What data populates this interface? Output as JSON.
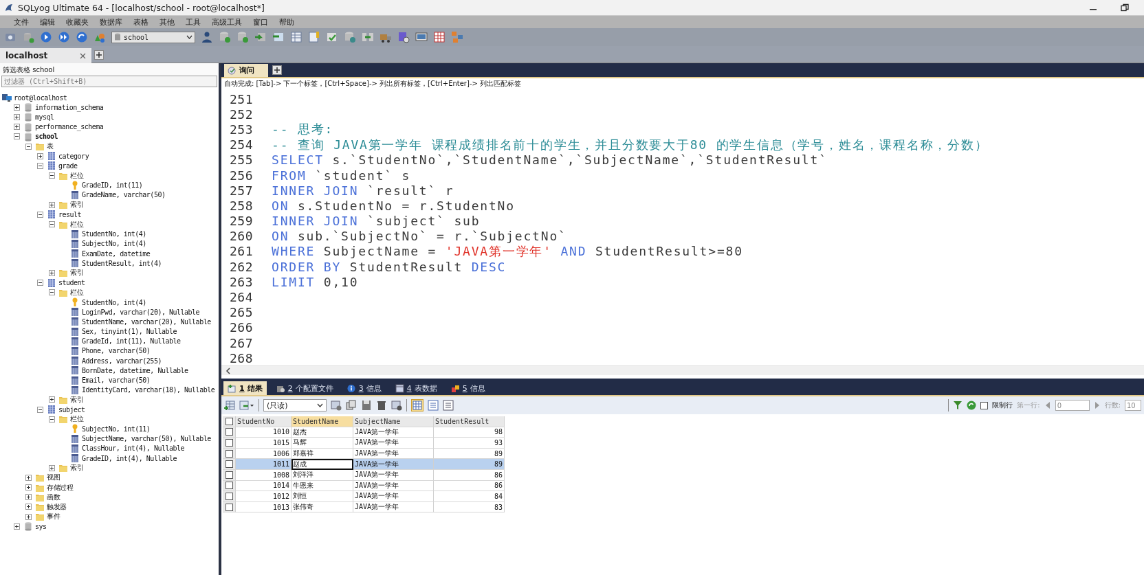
{
  "window": {
    "title": "SQLyog Ultimate 64 - [localhost/school - root@localhost*]"
  },
  "menu": [
    "文件",
    "编辑",
    "收藏夹",
    "数据库",
    "表格",
    "其他",
    "工具",
    "高级工具",
    "窗口",
    "帮助"
  ],
  "toolbar": {
    "database_select": "school"
  },
  "connection_tabs": [
    {
      "label": "localhost",
      "selected": true
    }
  ],
  "object_browser": {
    "header": "筛选表格 school",
    "filter": {
      "placeholder": "过滤器 (Ctrl+Shift+B)"
    },
    "tree": {
      "label": "root@localhost",
      "kind": "server",
      "children": [
        {
          "label": "information_schema",
          "kind": "database",
          "expanded": false,
          "active": false
        },
        {
          "label": "mysql",
          "kind": "database",
          "expanded": false,
          "active": false
        },
        {
          "label": "performance_schema",
          "kind": "database",
          "expanded": false,
          "active": false
        },
        {
          "label": "school",
          "kind": "database",
          "expanded": true,
          "active": true,
          "children": [
            {
              "label": "表",
              "kind": "folder",
              "expanded": true,
              "children": [
                {
                  "label": "category",
                  "kind": "table",
                  "expanded": false
                },
                {
                  "label": "grade",
                  "kind": "table",
                  "expanded": true,
                  "children": [
                    {
                      "label": "栏位",
                      "kind": "folder",
                      "expanded": true,
                      "children": [
                        {
                          "label": "GradeID, int(11)",
                          "kind": "key"
                        },
                        {
                          "label": "GradeName, varchar(50)",
                          "kind": "column"
                        }
                      ]
                    },
                    {
                      "label": "索引",
                      "kind": "folder",
                      "expanded": false
                    }
                  ]
                },
                {
                  "label": "result",
                  "kind": "table",
                  "expanded": true,
                  "children": [
                    {
                      "label": "栏位",
                      "kind": "folder",
                      "expanded": true,
                      "children": [
                        {
                          "label": "StudentNo, int(4)",
                          "kind": "column"
                        },
                        {
                          "label": "SubjectNo, int(4)",
                          "kind": "column"
                        },
                        {
                          "label": "ExamDate, datetime",
                          "kind": "column"
                        },
                        {
                          "label": "StudentResult, int(4)",
                          "kind": "column"
                        }
                      ]
                    },
                    {
                      "label": "索引",
                      "kind": "folder",
                      "expanded": false
                    }
                  ]
                },
                {
                  "label": "student",
                  "kind": "table",
                  "expanded": true,
                  "children": [
                    {
                      "label": "栏位",
                      "kind": "folder",
                      "expanded": true,
                      "children": [
                        {
                          "label": "StudentNo, int(4)",
                          "kind": "key"
                        },
                        {
                          "label": "LoginPwd, varchar(20), Nullable",
                          "kind": "column"
                        },
                        {
                          "label": "StudentName, varchar(20), Nullable",
                          "kind": "column"
                        },
                        {
                          "label": "Sex, tinyint(1), Nullable",
                          "kind": "column"
                        },
                        {
                          "label": "GradeId, int(11), Nullable",
                          "kind": "column"
                        },
                        {
                          "label": "Phone, varchar(50)",
                          "kind": "column"
                        },
                        {
                          "label": "Address, varchar(255)",
                          "kind": "column"
                        },
                        {
                          "label": "BornDate, datetime, Nullable",
                          "kind": "column"
                        },
                        {
                          "label": "Email, varchar(50)",
                          "kind": "column"
                        },
                        {
                          "label": "IdentityCard, varchar(18), Nullable",
                          "kind": "column"
                        }
                      ]
                    },
                    {
                      "label": "索引",
                      "kind": "folder",
                      "expanded": false
                    }
                  ]
                },
                {
                  "label": "subject",
                  "kind": "table",
                  "expanded": true,
                  "children": [
                    {
                      "label": "栏位",
                      "kind": "folder",
                      "expanded": true,
                      "children": [
                        {
                          "label": "SubjectNo, int(11)",
                          "kind": "key"
                        },
                        {
                          "label": "SubjectName, varchar(50), Nullable",
                          "kind": "column"
                        },
                        {
                          "label": "ClassHour, int(4), Nullable",
                          "kind": "column"
                        },
                        {
                          "label": "GradeID, int(4), Nullable",
                          "kind": "column"
                        }
                      ]
                    },
                    {
                      "label": "索引",
                      "kind": "folder",
                      "expanded": false
                    }
                  ]
                }
              ]
            },
            {
              "label": "视图",
              "kind": "folder",
              "expanded": false
            },
            {
              "label": "存储过程",
              "kind": "folder",
              "expanded": false
            },
            {
              "label": "函数",
              "kind": "folder",
              "expanded": false
            },
            {
              "label": "触发器",
              "kind": "folder",
              "expanded": false
            },
            {
              "label": "事件",
              "kind": "folder",
              "expanded": false
            }
          ]
        },
        {
          "label": "sys",
          "kind": "database",
          "expanded": false,
          "active": false
        }
      ]
    }
  },
  "editor_tabs": [
    {
      "label": "询问",
      "selected": true
    }
  ],
  "hint": "自动完成: [Tab]-> 下一个标签，[Ctrl+Space]-> 列出所有标签，[Ctrl+Enter]-> 列出匹配标签",
  "code_lines": [
    {
      "number": "251"
    },
    {
      "number": "252"
    },
    {
      "number": "253",
      "tokens": [
        {
          "kind": "comment",
          "text": "-- 思考:"
        }
      ]
    },
    {
      "number": "254",
      "tokens": [
        {
          "kind": "comment",
          "text": "-- 查询 JAVA第一学年 课程成绩排名前十的学生，并且分数要大于80 的学生信息（学号，姓名，课程名称，分数）"
        }
      ]
    },
    {
      "number": "255",
      "tokens": [
        {
          "kind": "keyword",
          "text": "SELECT"
        },
        {
          "kind": "plain",
          "text": " s.`StudentNo`,`StudentName`,`SubjectName`,`StudentResult`"
        }
      ]
    },
    {
      "number": "256",
      "tokens": [
        {
          "kind": "keyword",
          "text": "FROM"
        },
        {
          "kind": "plain",
          "text": " `student` s"
        }
      ]
    },
    {
      "number": "257",
      "tokens": [
        {
          "kind": "keyword",
          "text": "INNER JOIN"
        },
        {
          "kind": "plain",
          "text": " `result` r"
        }
      ]
    },
    {
      "number": "258",
      "tokens": [
        {
          "kind": "keyword",
          "text": "ON"
        },
        {
          "kind": "plain",
          "text": " s.StudentNo = r.StudentNo"
        }
      ]
    },
    {
      "number": "259",
      "tokens": [
        {
          "kind": "keyword",
          "text": "INNER JOIN"
        },
        {
          "kind": "plain",
          "text": " `subject` sub"
        }
      ]
    },
    {
      "number": "260",
      "tokens": [
        {
          "kind": "keyword",
          "text": "ON"
        },
        {
          "kind": "plain",
          "text": " sub.`SubjectNo` = r.`SubjectNo`"
        }
      ]
    },
    {
      "number": "261",
      "tokens": [
        {
          "kind": "keyword",
          "text": "WHERE"
        },
        {
          "kind": "plain",
          "text": " SubjectName = "
        },
        {
          "kind": "string",
          "text": "'JAVA第一学年'"
        },
        {
          "kind": "keyword",
          "text": " AND"
        },
        {
          "kind": "plain",
          "text": " StudentResult>=80"
        }
      ]
    },
    {
      "number": "262",
      "tokens": [
        {
          "kind": "keyword",
          "text": "ORDER BY"
        },
        {
          "kind": "plain",
          "text": " StudentResult "
        },
        {
          "kind": "keyword",
          "text": "DESC"
        }
      ]
    },
    {
      "number": "263",
      "tokens": [
        {
          "kind": "keyword",
          "text": "LIMIT"
        },
        {
          "kind": "plain",
          "text": " 0,10"
        }
      ]
    },
    {
      "number": "264"
    },
    {
      "number": "265"
    },
    {
      "number": "266"
    },
    {
      "number": "267"
    },
    {
      "number": "268"
    }
  ],
  "result_tabs": [
    {
      "key": "1",
      "label": "结果",
      "selected": true
    },
    {
      "key": "2",
      "label": "个配置文件",
      "selected": false
    },
    {
      "key": "3",
      "label": "信息",
      "selected": false
    },
    {
      "key": "4",
      "label": "表数据",
      "selected": false
    },
    {
      "key": "5",
      "label": "信息",
      "selected": false
    }
  ],
  "result_toolbar": {
    "mode": "(只读)",
    "limit_rows": {
      "label": "限制行",
      "checked": false
    },
    "first_row_label": "第一行:",
    "first_row": "0",
    "row_count_label": "行数:",
    "row_count": "10"
  },
  "result_grid": {
    "select_all": {
      "checked": false
    },
    "columns": [
      {
        "label": "StudentNo",
        "selected": false
      },
      {
        "label": "StudentName",
        "selected": true
      },
      {
        "label": "SubjectName",
        "selected": false
      },
      {
        "label": "StudentResult",
        "selected": false
      }
    ],
    "rows": [
      {
        "cells": [
          "1010",
          "赵杰",
          "JAVA第一学年",
          "98"
        ],
        "checked": false,
        "selected": false
      },
      {
        "cells": [
          "1015",
          "马辉",
          "JAVA第一学年",
          "93"
        ],
        "checked": false,
        "selected": false
      },
      {
        "cells": [
          "1006",
          "郑嘉祥",
          "JAVA第一学年",
          "89"
        ],
        "checked": false,
        "selected": false
      },
      {
        "cells": [
          "1011",
          "赵成",
          "JAVA第一学年",
          "89"
        ],
        "checked": false,
        "selected": true
      },
      {
        "cells": [
          "1008",
          "刘洋洋",
          "JAVA第一学年",
          "86"
        ],
        "checked": false,
        "selected": false
      },
      {
        "cells": [
          "1014",
          "牛恩来",
          "JAVA第一学年",
          "86"
        ],
        "checked": false,
        "selected": false
      },
      {
        "cells": [
          "1012",
          "刘恒",
          "JAVA第一学年",
          "84"
        ],
        "checked": false,
        "selected": false
      },
      {
        "cells": [
          "1013",
          "张伟奇",
          "JAVA第一学年",
          "83"
        ],
        "checked": false,
        "selected": false
      }
    ]
  }
}
